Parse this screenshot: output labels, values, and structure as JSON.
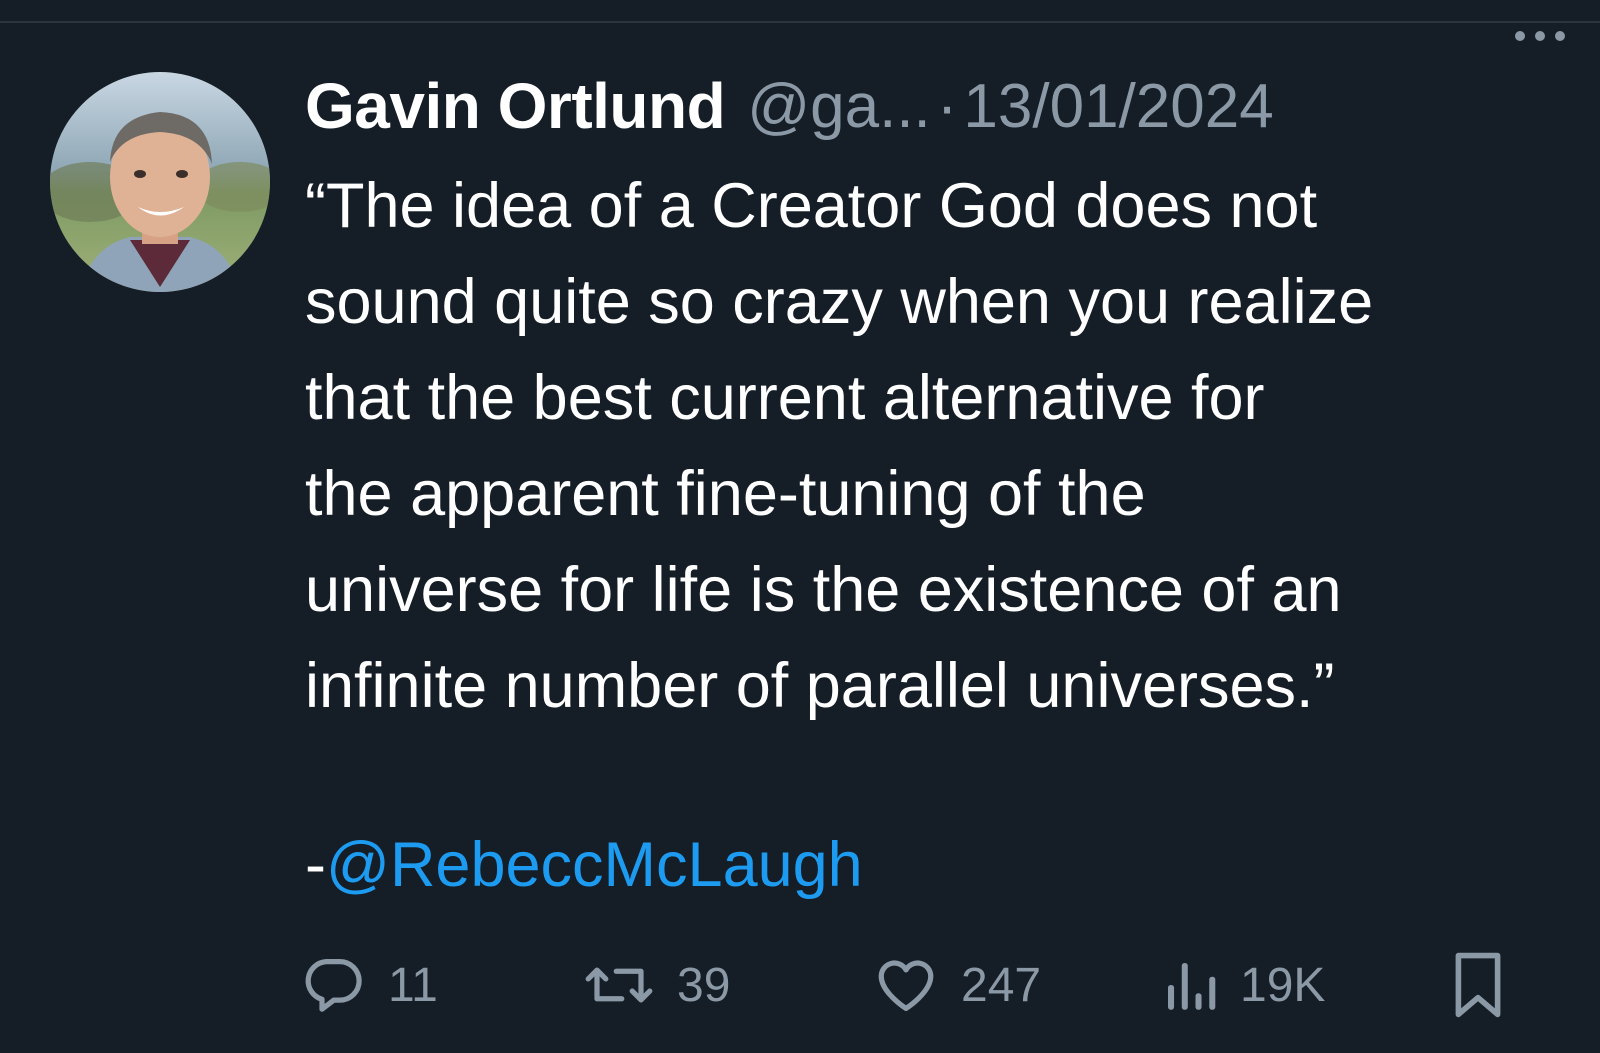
{
  "tweet": {
    "author_name": "Gavin Ortlund",
    "handle": "@ga...",
    "separator": "·",
    "date": "13/01/2024",
    "body_lines": [
      "“The idea of a Creator God does not",
      "sound quite so crazy when you realize",
      "that the best current alternative for",
      "the apparent fine-tuning of the",
      "universe for life is the existence of an",
      "infinite number of parallel universes.”"
    ],
    "attribution_prefix": "-",
    "attribution_mention": "@RebeccMcLaugh"
  },
  "actions": {
    "replies": "11",
    "reposts": "39",
    "likes": "247",
    "views": "19K"
  },
  "icons": {
    "more": "more-icon",
    "reply": "reply-icon",
    "repost": "repost-icon",
    "like": "like-icon",
    "views": "views-icon",
    "bookmark": "bookmark-icon"
  },
  "colors": {
    "background": "#151d26",
    "text_primary": "#ffffff",
    "text_secondary": "#8b98a5",
    "mention": "#1d9bf0"
  }
}
